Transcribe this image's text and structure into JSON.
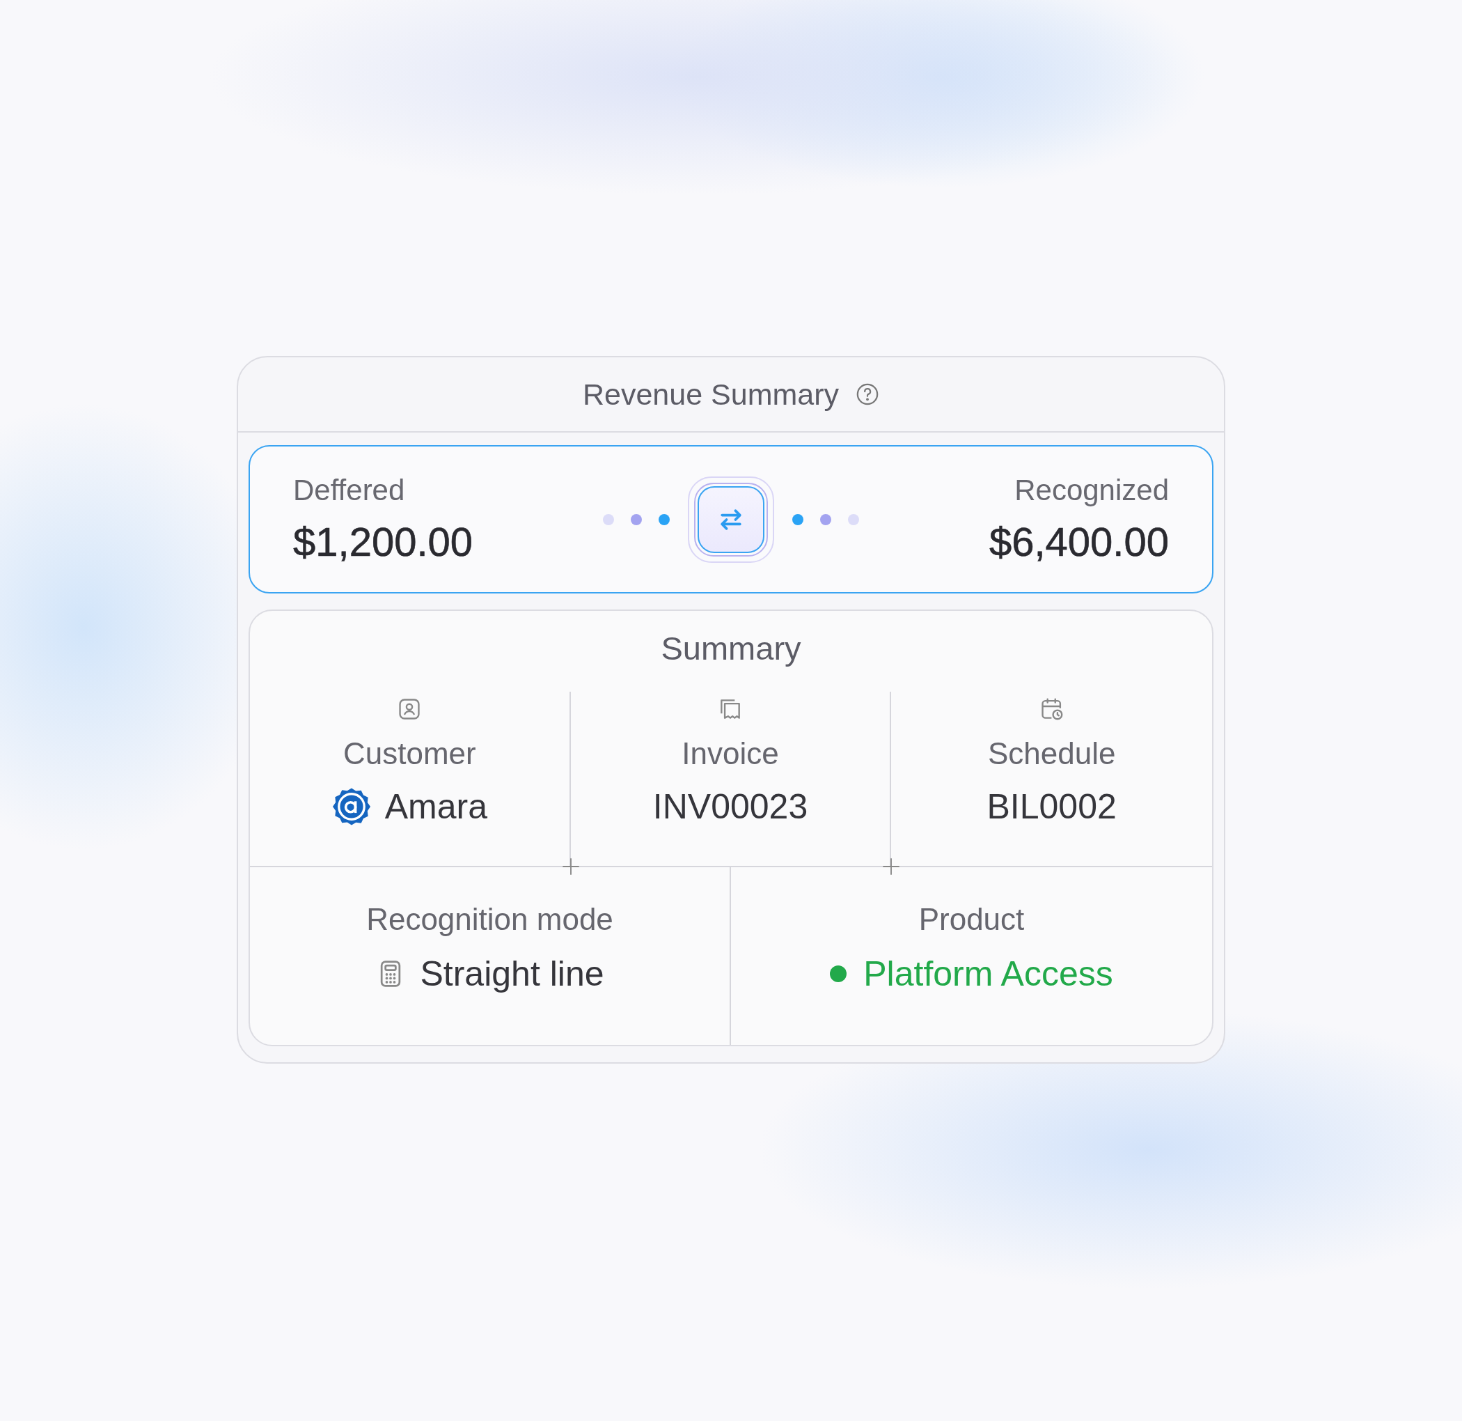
{
  "card": {
    "title": "Revenue Summary"
  },
  "transfer": {
    "from": {
      "label": "Deffered",
      "amount": "$1,200.00"
    },
    "to": {
      "label": "Recognized",
      "amount": "$6,400.00"
    }
  },
  "summary": {
    "title": "Summary",
    "top": [
      {
        "kind": "customer",
        "label": "Customer",
        "value": "Amara"
      },
      {
        "kind": "invoice",
        "label": "Invoice",
        "value": "INV00023"
      },
      {
        "kind": "schedule",
        "label": "Schedule",
        "value": "BIL0002"
      }
    ],
    "bottom": [
      {
        "kind": "mode",
        "label": "Recognition mode",
        "value": "Straight line"
      },
      {
        "kind": "product",
        "label": "Product",
        "value": "Platform Access",
        "color": "#22a94a"
      }
    ]
  }
}
